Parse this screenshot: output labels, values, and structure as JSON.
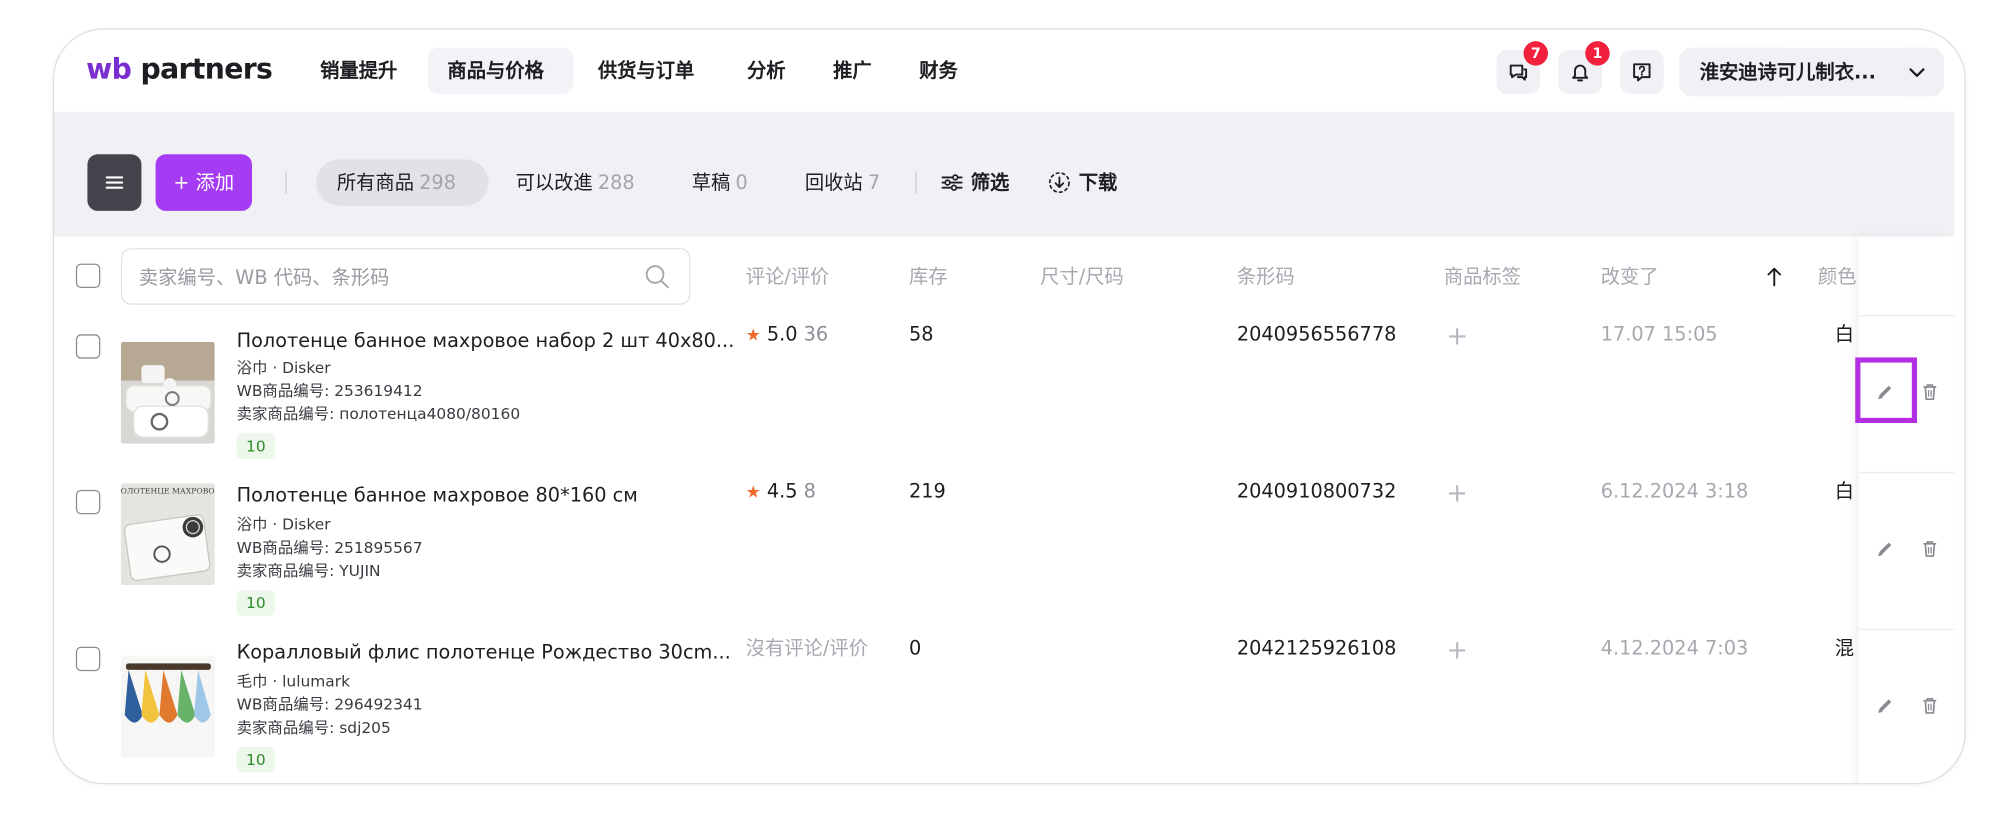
{
  "brand": {
    "logo_wb": "wb",
    "logo_partners": "partners"
  },
  "nav": {
    "items": [
      {
        "label": "销量提升"
      },
      {
        "label": "商品与价格"
      },
      {
        "label": "供货与订单"
      },
      {
        "label": "分析"
      },
      {
        "label": "推广"
      },
      {
        "label": "财务"
      }
    ],
    "active_index": 1
  },
  "header": {
    "chat_badge": "7",
    "notify_badge": "1",
    "account_name": "淮安迪诗可儿制衣..."
  },
  "toolbar": {
    "add_label": "+ 添加",
    "tabs": [
      {
        "label": "所有商品",
        "count": "298"
      },
      {
        "label": "可以改進",
        "count": "288"
      },
      {
        "label": "草稿",
        "count": "0"
      },
      {
        "label": "回收站",
        "count": "7"
      }
    ],
    "filter_label": "筛选",
    "download_label": "下载"
  },
  "search": {
    "placeholder": "卖家编号、WB 代码、条形码"
  },
  "table": {
    "columns": [
      {
        "label": "评论/评价"
      },
      {
        "label": "库存"
      },
      {
        "label": "尺寸/尺码"
      },
      {
        "label": "条形码"
      },
      {
        "label": "商品标签"
      },
      {
        "label": "改变了"
      },
      {
        "label": "颜色"
      }
    ],
    "rows": [
      {
        "title": "Полотенце банное махровое набор 2 шт 40x80...",
        "category": "浴巾 · Disker",
        "wb_code": "WB商品编号: 253619412",
        "seller_code": "卖家商品编号: полотенца4080/80160",
        "badge": "10",
        "rating": "5.0",
        "rating_count": "36",
        "stock": "58",
        "barcode": "2040956556778",
        "changed": "17.07 15:05",
        "color": "白"
      },
      {
        "title": "Полотенце банное махровое 80*160 см",
        "category": "浴巾 · Disker",
        "wb_code": "WB商品编号: 251895567",
        "seller_code": "卖家商品编号: YUJIN",
        "badge": "10",
        "rating": "4.5",
        "rating_count": "8",
        "stock": "219",
        "barcode": "2040910800732",
        "changed": "6.12.2024 3:18",
        "color": "白"
      },
      {
        "title": "Коралловый флис полотенце Рождество 30cm...",
        "category": "毛巾 · lulumark",
        "wb_code": "WB商品编号: 296492341",
        "seller_code": "卖家商品编号: sdj205",
        "badge": "10",
        "no_reviews": "沒有评论/评价",
        "stock": "0",
        "barcode": "2042125926108",
        "changed": "4.12.2024 7:03",
        "color": "混"
      }
    ],
    "thumb_top_text": "ПОЛОТЕНЦЕ МАХРОВОЕ"
  },
  "colors": {
    "brand_purple": "#a53cf4",
    "highlight": "#b32ee0",
    "badge_red": "#f2203c",
    "star_orange": "#f36b2c"
  },
  "icons": [
    "chat-icon",
    "bell-icon",
    "help-icon",
    "chevron-down-icon",
    "menu-icon",
    "filter-icon",
    "download-icon",
    "search-icon",
    "sort-arrow-icon",
    "edit-icon",
    "trash-icon"
  ]
}
